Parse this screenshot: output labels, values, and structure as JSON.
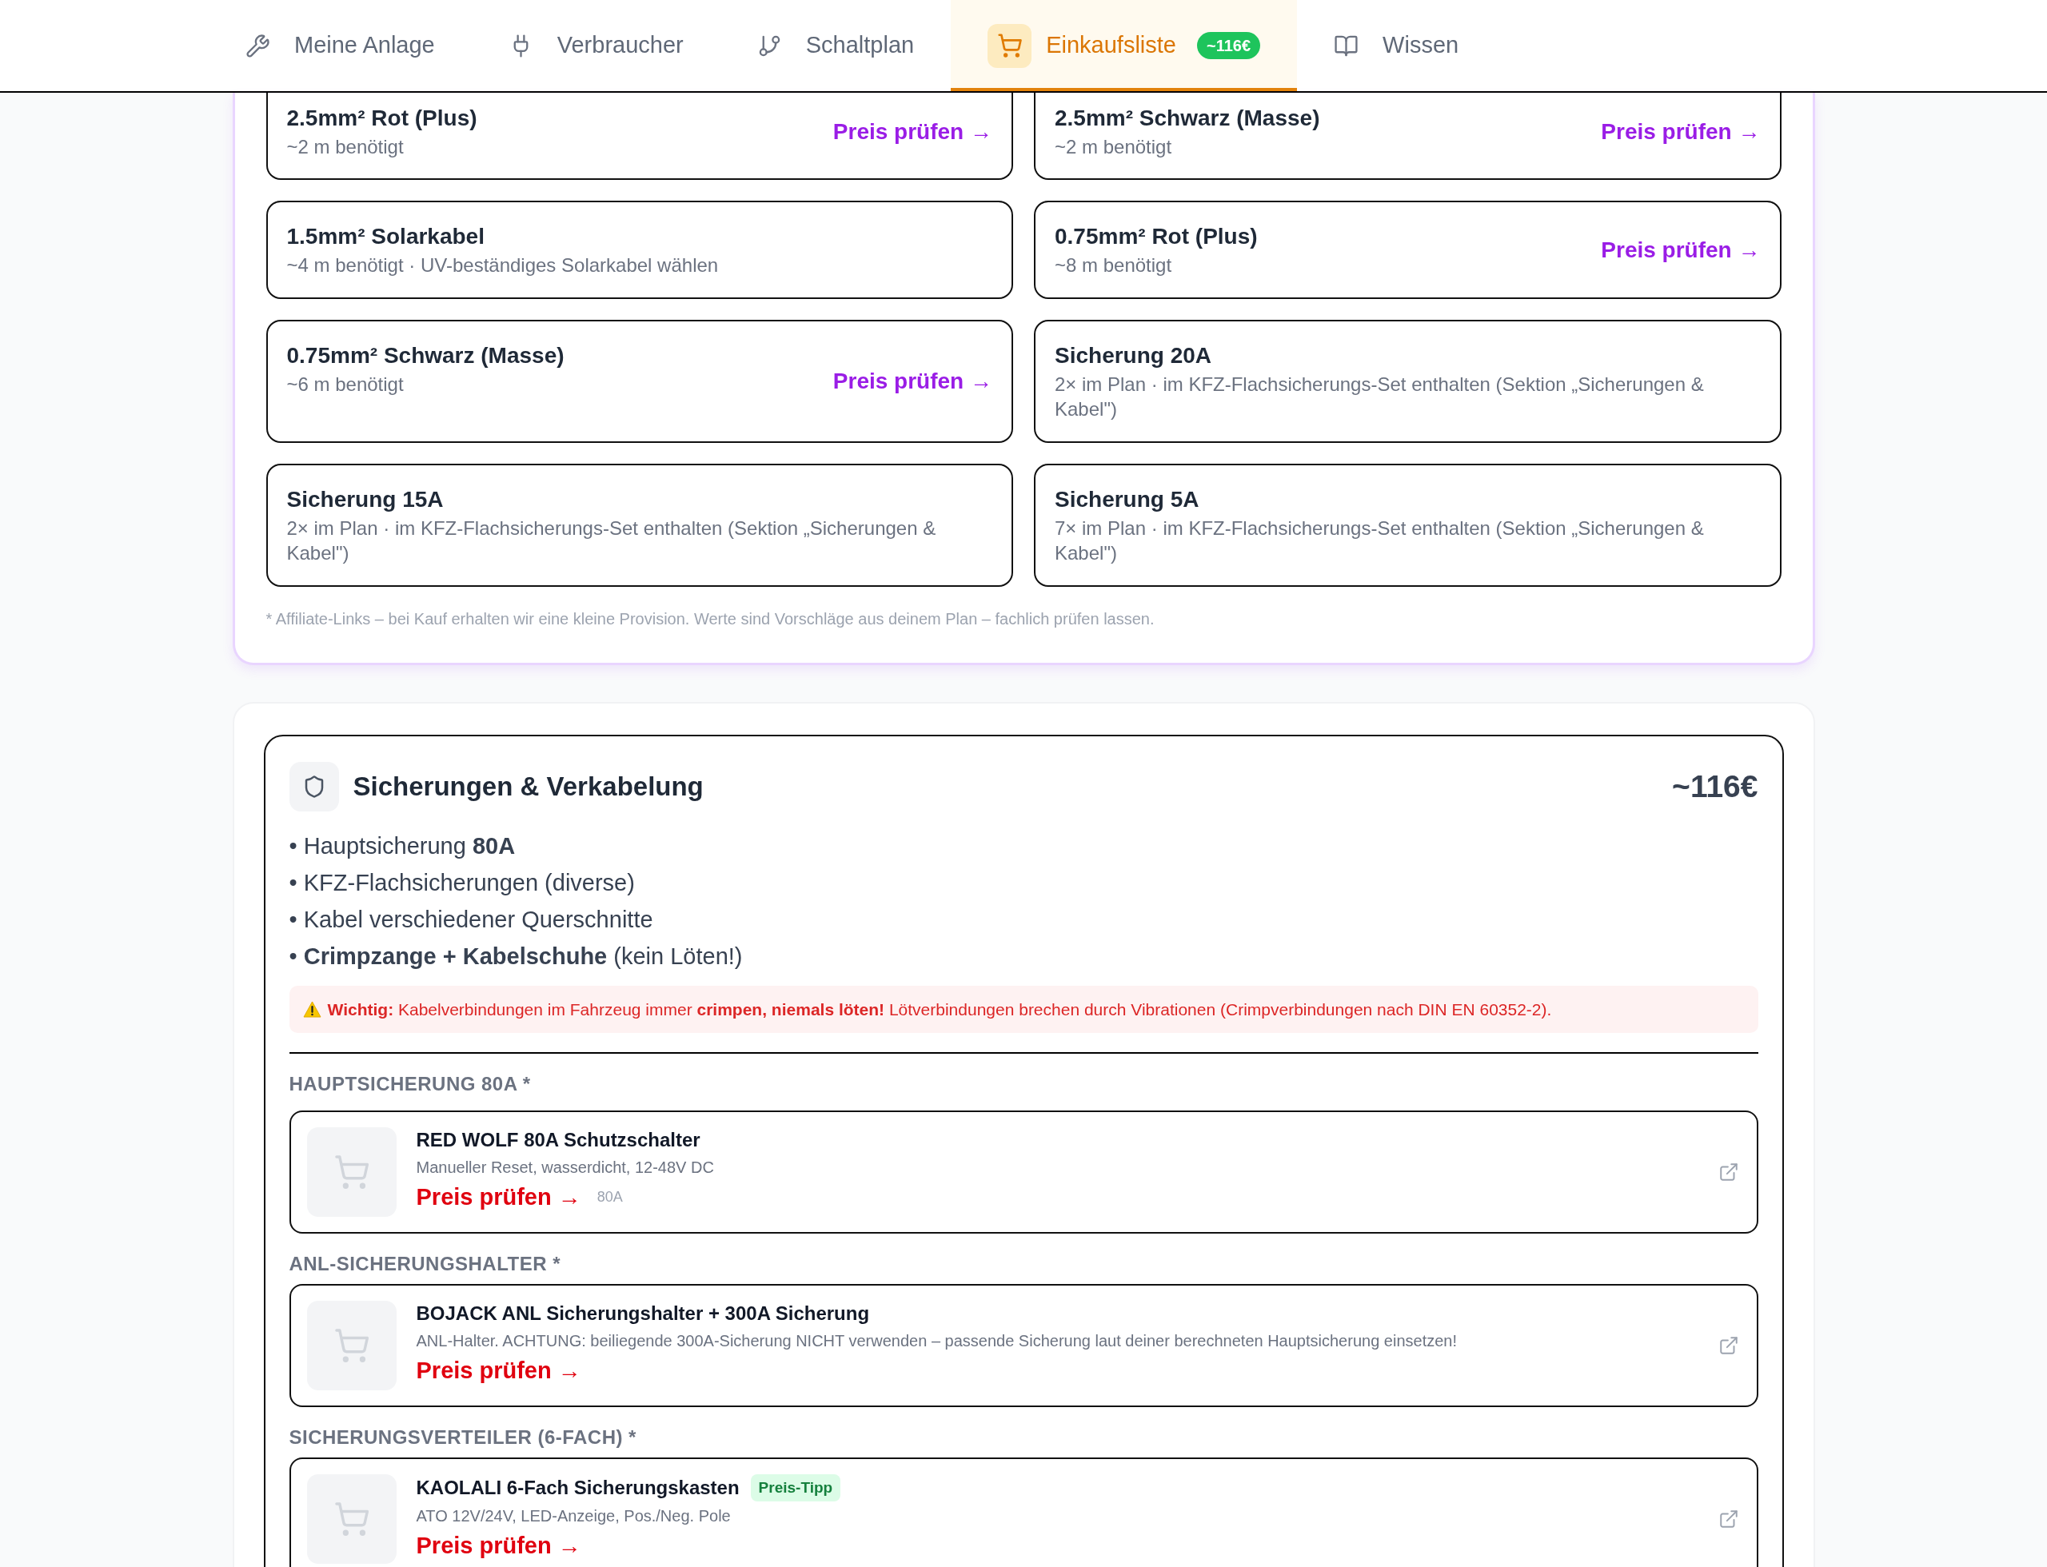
{
  "nav": {
    "tabs": [
      {
        "label": "Meine Anlage",
        "selected": false
      },
      {
        "label": "Verbraucher",
        "selected": false
      },
      {
        "label": "Schaltplan",
        "selected": false
      },
      {
        "label": "Einkaufsliste",
        "selected": true,
        "badge": "~116€"
      },
      {
        "label": "Wissen",
        "selected": false
      }
    ]
  },
  "cable_list": {
    "items": [
      {
        "title": "2.5mm² Rot (Plus)",
        "detail": "~2 m benötigt",
        "link": "Preis prüfen →"
      },
      {
        "title": "2.5mm² Schwarz (Masse)",
        "detail": "~2 m benötigt",
        "link": "Preis prüfen →"
      },
      {
        "title": "1.5mm² Solarkabel",
        "detail": "~4 m benötigt · UV-beständiges Solarkabel wählen"
      },
      {
        "title": "0.75mm² Rot (Plus)",
        "detail": "~8 m benötigt",
        "link": "Preis prüfen →"
      },
      {
        "title": "0.75mm² Schwarz (Masse)",
        "detail": "~6 m benötigt",
        "link": "Preis prüfen →"
      },
      {
        "title": "Sicherung 20A",
        "detail": "2× im Plan · im KFZ-Flachsicherungs-Set enthalten (Sektion „Sicherungen & Kabel\")"
      },
      {
        "title": "Sicherung 15A",
        "detail": "2× im Plan · im KFZ-Flachsicherungs-Set enthalten (Sektion „Sicherungen & Kabel\")"
      },
      {
        "title": "Sicherung 5A",
        "detail": "7× im Plan · im KFZ-Flachsicherungs-Set enthalten (Sektion „Sicherungen & Kabel\")"
      }
    ],
    "footnote": "* Affiliate-Links – bei Kauf erhalten wir eine kleine Provision. Werte sind Vorschläge aus deinem Plan – fachlich prüfen lassen."
  },
  "fuse_section": {
    "title": "Sicherungen & Verkabelung",
    "price": "~116€",
    "bullets": [
      "• Hauptsicherung **80A**",
      "• KFZ-Flachsicherungen (diverse)",
      "• Kabel verschiedener Querschnitte",
      "• **Crimpzange + Kabelschuhe** (kein Löten!)"
    ],
    "warning": "**Wichtig:** Kabelverbindungen im Fahrzeug immer **crimpen, niemals löten!** Lötverbindungen brechen durch Vibrationen (Crimpverbindungen nach DIN EN 60352-2).",
    "groups": [
      {
        "label": "HAUPTSICHERUNG 80A *",
        "product": {
          "name": "RED WOLF 80A Schutzschalter",
          "description": "Manueller Reset, wasserdicht, 12-48V DC",
          "link": "Preis prüfen →",
          "spec": "80A"
        }
      },
      {
        "label": "ANL-SICHERUNGSHALTER *",
        "product": {
          "name": "BOJACK ANL Sicherungshalter + 300A Sicherung",
          "description": "ANL-Halter. ACHTUNG: beiliegende 300A-Sicherung NICHT verwenden – passende Sicherung laut deiner berechneten Hauptsicherung einsetzen!",
          "link": "Preis prüfen →"
        }
      },
      {
        "label": "SICHERUNGSVERTEILER (6-FACH) *",
        "product": {
          "name": "KAOLALI 6-Fach Sicherungskasten",
          "badge": "Preis-Tipp",
          "description": "ATO 12V/24V, LED-Anzeige, Pos./Neg. Pole",
          "link": "Preis prüfen →"
        }
      }
    ]
  }
}
